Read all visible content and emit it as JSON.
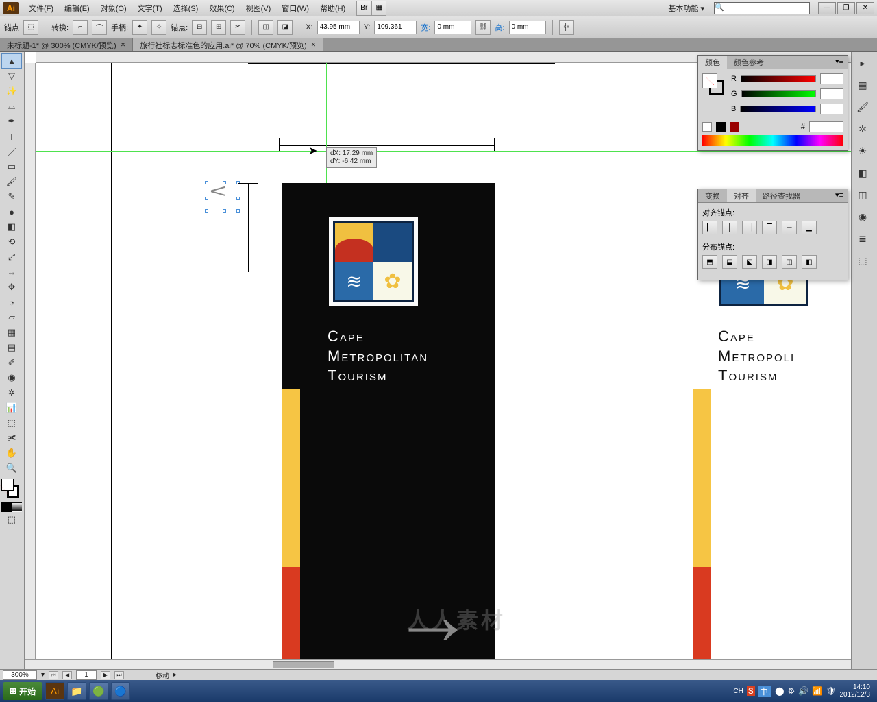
{
  "menu": {
    "items": [
      "文件(F)",
      "编辑(E)",
      "对象(O)",
      "文字(T)",
      "选择(S)",
      "效果(C)",
      "视图(V)",
      "窗口(W)",
      "帮助(H)"
    ],
    "workspace": "基本功能"
  },
  "control": {
    "anchor": "锚点",
    "convert": "转换:",
    "handle": "手柄:",
    "anchors": "锚点:",
    "x_label": "X:",
    "x_val": "43.95 mm",
    "y_label": "Y:",
    "y_val": "109.361",
    "w_label": "宽:",
    "w_val": "0 mm",
    "h_label": "高:",
    "h_val": "0 mm"
  },
  "tabs": [
    {
      "label": "未标题-1* @ 300% (CMYK/预览)",
      "active": false
    },
    {
      "label": "旅行社标志标准色的应用.ai* @ 70% (CMYK/预览)",
      "active": true
    }
  ],
  "measure": {
    "dx": "dX: 17.29 mm",
    "dy": "dY: -6.42 mm"
  },
  "poster": {
    "line1": "Cape",
    "line2": "Metropolitan",
    "line3": "Tourism"
  },
  "poster2": {
    "line1": "Cape",
    "line2": "Metropoli",
    "line3": "Tourism"
  },
  "color_panel": {
    "tab1": "颜色",
    "tab2": "颜色参考",
    "r": "R",
    "g": "G",
    "b": "B",
    "hex": "#"
  },
  "align_panel": {
    "tab1": "变换",
    "tab2": "对齐",
    "tab3": "路径查找器",
    "sec1": "对齐锚点:",
    "sec2": "分布锚点:"
  },
  "status": {
    "zoom": "300%",
    "page": "1",
    "action": "移动"
  },
  "taskbar": {
    "start": "开始",
    "lang": "CH",
    "ime": "中,",
    "time": "14:10",
    "date": "2012/12/3"
  },
  "watermark": "人人素材"
}
